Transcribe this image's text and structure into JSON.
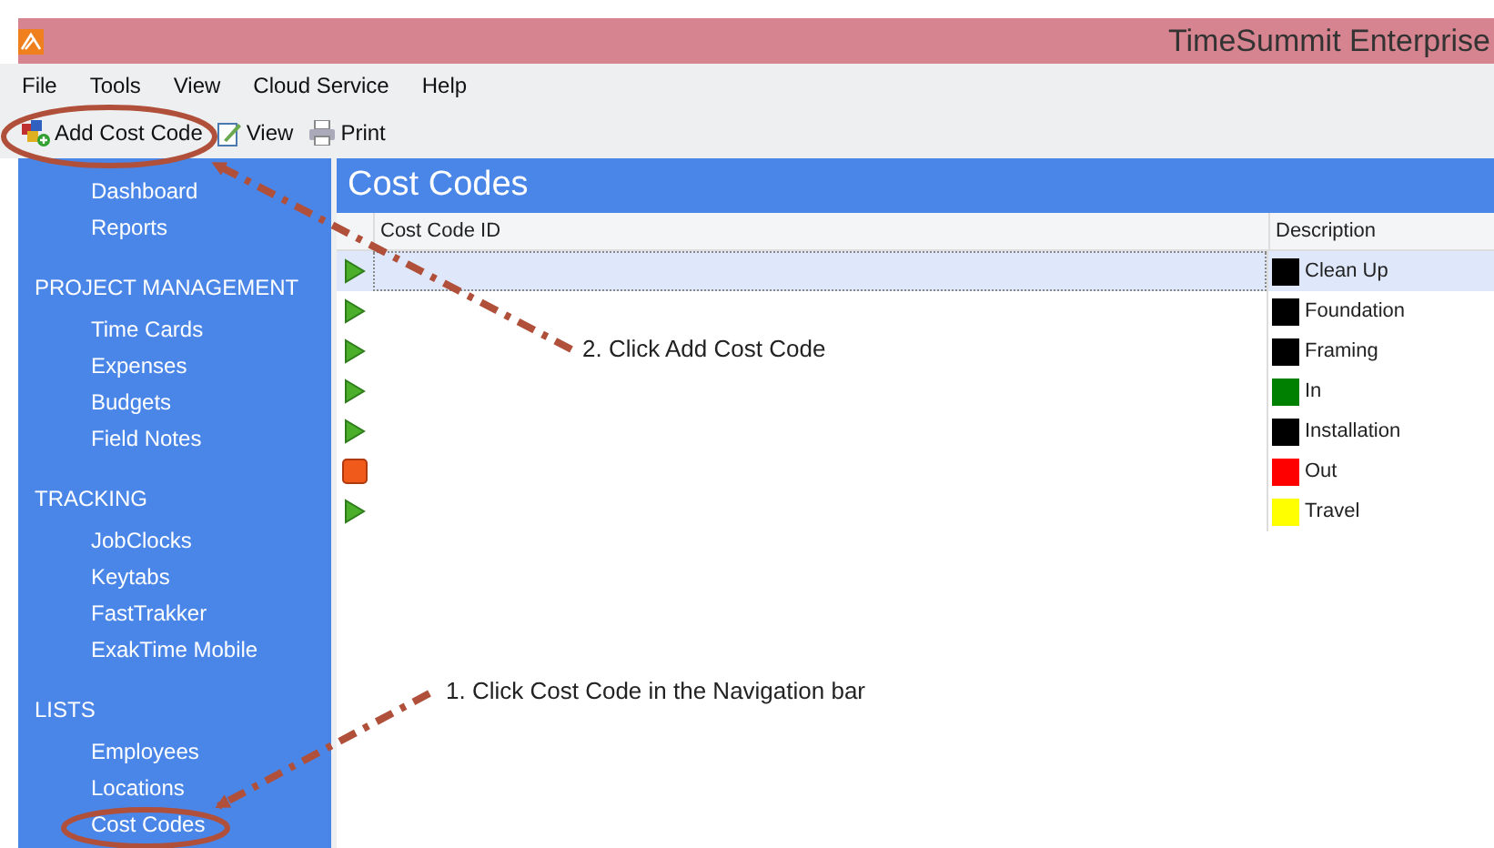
{
  "window": {
    "title": "TimeSummit Enterprise"
  },
  "menu": [
    "File",
    "Tools",
    "View",
    "Cloud Service",
    "Help"
  ],
  "toolbar": [
    {
      "label": "Add Cost Code",
      "kind": "add"
    },
    {
      "label": "View",
      "kind": "edit"
    },
    {
      "label": "Print",
      "kind": "print"
    }
  ],
  "sidebar": {
    "groups": [
      {
        "items": [
          "Dashboard",
          "Reports"
        ]
      },
      {
        "heading": "PROJECT MANAGEMENT",
        "items": [
          "Time Cards",
          "Expenses",
          "Budgets",
          "Field Notes"
        ]
      },
      {
        "heading": "TRACKING",
        "items": [
          "JobClocks",
          "Keytabs",
          "FastTrakker",
          "ExakTime Mobile"
        ]
      },
      {
        "heading": "LISTS",
        "items": [
          "Employees",
          "Locations",
          "Cost Codes"
        ]
      }
    ]
  },
  "page": {
    "title": "Cost Codes"
  },
  "table": {
    "columns": [
      "Cost Code ID",
      "Description"
    ],
    "rows": [
      {
        "kind": "go",
        "selected": true,
        "description": "Clean Up",
        "color": "#000000"
      },
      {
        "kind": "go",
        "selected": false,
        "description": "Foundation",
        "color": "#000000"
      },
      {
        "kind": "go",
        "selected": false,
        "description": "Framing",
        "color": "#000000"
      },
      {
        "kind": "go",
        "selected": false,
        "description": "In",
        "color": "#008000"
      },
      {
        "kind": "go",
        "selected": false,
        "description": "Installation",
        "color": "#000000"
      },
      {
        "kind": "stop",
        "selected": false,
        "description": "Out",
        "color": "#ff0000"
      },
      {
        "kind": "go",
        "selected": false,
        "description": "Travel",
        "color": "#ffff00"
      }
    ]
  },
  "annotations": [
    "2. Click Add Cost Code",
    "1. Click Cost Code in the Navigation bar"
  ]
}
